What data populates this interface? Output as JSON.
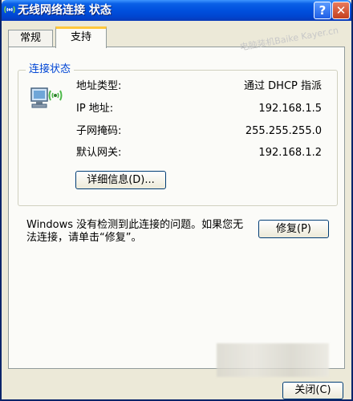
{
  "window": {
    "title": "无线网络连接 状态",
    "help_glyph": "?",
    "close_glyph": "✕",
    "title_icon": "wireless-icon"
  },
  "tabs": [
    {
      "label": "常规",
      "active": false
    },
    {
      "label": "支持",
      "active": true
    }
  ],
  "watermark": "电脑装机Baike Kayer.cn",
  "connection_status": {
    "legend": "连接状态",
    "icon": "wireless-network-icon",
    "rows": [
      {
        "label": "地址类型:",
        "value": "通过 DHCP 指派"
      },
      {
        "label": "IP 地址:",
        "value": "192.168.1.5"
      },
      {
        "label": "子网掩码:",
        "value": "255.255.255.0"
      },
      {
        "label": "默认网关:",
        "value": "192.168.1.2"
      }
    ],
    "details_button": "详细信息(D)..."
  },
  "message": "Windows 没有检测到此连接的问题。如果您无法连接，请单击“修复”。",
  "repair_button": "修复(P)",
  "close_button": "关闭(C)"
}
